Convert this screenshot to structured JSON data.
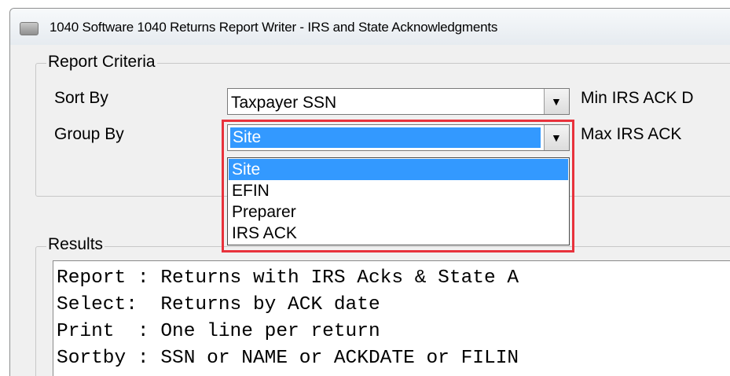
{
  "window": {
    "title": "1040 Software 1040 Returns Report Writer - IRS and State Acknowledgments"
  },
  "report_criteria": {
    "legend": "Report Criteria",
    "sort_by_label": "Sort By",
    "sort_by_value": "Taxpayer SSN",
    "group_by_label": "Group By",
    "group_by_value": "Site",
    "group_by_options": [
      "Site",
      "EFIN",
      "Preparer",
      "IRS ACK"
    ],
    "group_by_selected_index": 0,
    "min_ack_label": "Min IRS ACK D",
    "max_ack_label": "Max IRS ACK"
  },
  "results": {
    "legend": "Results",
    "lines": [
      "Report : Returns with IRS Acks & State A",
      "Select:  Returns by ACK date",
      "Print  : One line per return",
      "Sortby : SSN or NAME or ACKDATE or FILIN"
    ]
  },
  "colors": {
    "selection": "#3399ff",
    "callout": "#e8323c",
    "window_bg": "#f0f0f0"
  }
}
